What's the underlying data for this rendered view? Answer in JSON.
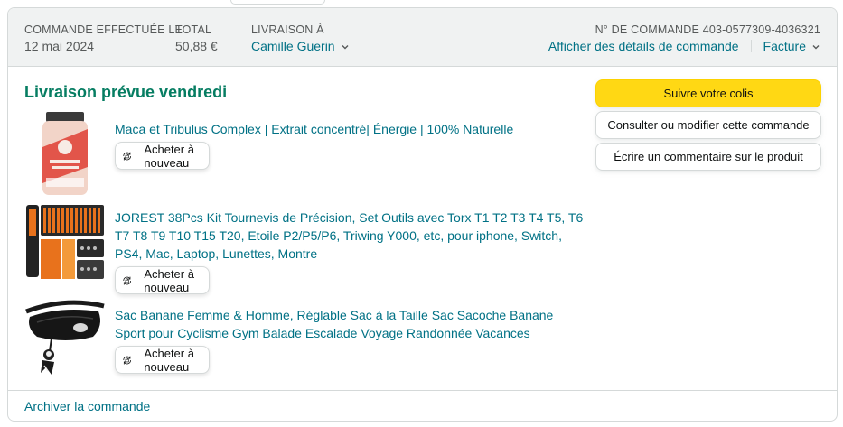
{
  "header": {
    "order_date_label": "COMMANDE EFFECTUÉE LE",
    "order_date": "12 mai 2024",
    "total_label": "TOTAL",
    "total": "50,88 €",
    "ship_to_label": "LIVRAISON À",
    "ship_to": "Camille Guerin",
    "order_number": "N° DE COMMANDE 403-0577309-4036321",
    "details_link": "Afficher des détails de commande",
    "invoice_link": "Facture"
  },
  "delivery": {
    "title": "Livraison prévue vendredi"
  },
  "items": [
    {
      "title": "Maca et Tribulus Complex | Extrait concentré| Énergie | 100% Naturelle",
      "rebuy_label": "Acheter à nouveau",
      "image": "supplement-bottle"
    },
    {
      "title": "JOREST 38Pcs Kit Tournevis de Précision, Set Outils avec Torx T1 T2 T3 T4 T5, T6 T7 T8 T9 T10 T15 T20, Etoile P2/P5/P6, Triwing Y000, etc, pour iphone, Switch, PS4, Mac, Laptop, Lunettes, Montre",
      "rebuy_label": "Acheter à nouveau",
      "image": "screwdriver-kit"
    },
    {
      "title": "Sac Banane Femme & Homme, Réglable Sac à la Taille Sac Sacoche Banane Sport pour Cyclisme Gym Balade Escalade Voyage Randonnée Vacances",
      "rebuy_label": "Acheter à nouveau",
      "image": "waist-bag"
    }
  ],
  "actions": {
    "track": "Suivre votre colis",
    "modify": "Consulter ou modifier cette commande",
    "review": "Écrire un commentaire sur le produit"
  },
  "footer": {
    "archive": "Archiver la commande"
  },
  "colors": {
    "link": "#007185",
    "delivery": "#067d62",
    "primary_button": "#ffd814",
    "header_bg": "#f0f2f2"
  }
}
